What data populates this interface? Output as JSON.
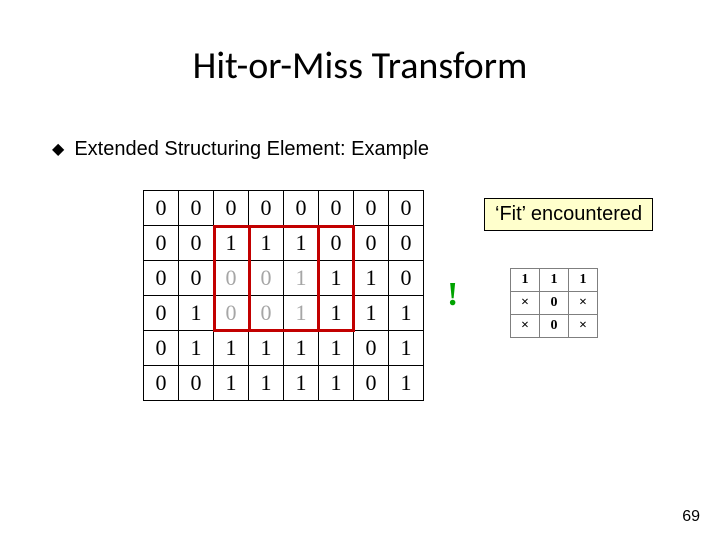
{
  "title": "Hit-or-Miss Transform",
  "bullet": {
    "text": "Extended Structuring Element: Example"
  },
  "grid": {
    "rows": [
      [
        "0",
        "0",
        "0",
        "0",
        "0",
        "0",
        "0",
        "0"
      ],
      [
        "0",
        "0",
        "1",
        "1",
        "1",
        "0",
        "0",
        "0"
      ],
      [
        "0",
        "0",
        "0",
        "0",
        "1",
        "1",
        "1",
        "0"
      ],
      [
        "0",
        "1",
        "0",
        "0",
        "1",
        "1",
        "1",
        "1"
      ],
      [
        "0",
        "1",
        "1",
        "1",
        "1",
        "1",
        "0",
        "1"
      ],
      [
        "0",
        "0",
        "1",
        "1",
        "1",
        "1",
        "0",
        "1"
      ]
    ],
    "gray": [
      {
        "r": 2,
        "c": 2
      },
      {
        "r": 2,
        "c": 3
      },
      {
        "r": 2,
        "c": 4
      },
      {
        "r": 3,
        "c": 2
      },
      {
        "r": 3,
        "c": 3
      },
      {
        "r": 3,
        "c": 4
      }
    ]
  },
  "exclaim": "!",
  "fit_label": "‘Fit’ encountered",
  "se": {
    "rows": [
      [
        "1",
        "1",
        "1"
      ],
      [
        "×",
        "0",
        "×"
      ],
      [
        "×",
        "0",
        "×"
      ]
    ]
  },
  "page_number": "69"
}
